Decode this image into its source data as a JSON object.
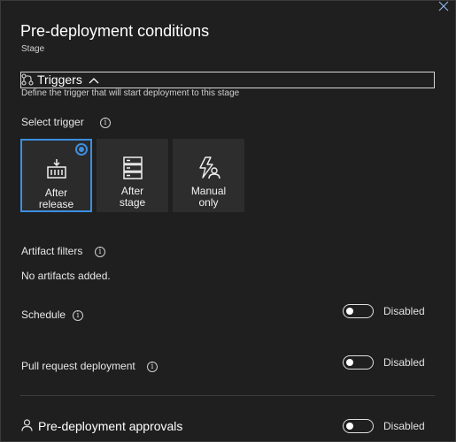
{
  "header": {
    "title": "Pre-deployment conditions",
    "subtitle": "Stage"
  },
  "triggers": {
    "label": "Triggers",
    "description": "Define the trigger that will start deployment to this stage",
    "select_trigger_label": "Select trigger",
    "options": [
      {
        "line1": "After",
        "line2": "release",
        "icon": "release-icon",
        "selected": true
      },
      {
        "line1": "After",
        "line2": "stage",
        "icon": "stage-icon",
        "selected": false
      },
      {
        "line1": "Manual",
        "line2": "only",
        "icon": "manual-icon",
        "selected": false
      }
    ]
  },
  "artifact_filters": {
    "label": "Artifact filters",
    "empty_text": "No artifacts added."
  },
  "schedule": {
    "label": "Schedule",
    "status": "Disabled"
  },
  "pull_request": {
    "label": "Pull request deployment",
    "status": "Disabled"
  },
  "approvals": {
    "label": "Pre-deployment approvals",
    "status": "Disabled"
  },
  "colors": {
    "accent": "#3c8fe0",
    "background": "#1f1f1f",
    "card": "#2d2d2d"
  },
  "info_glyph": "i"
}
